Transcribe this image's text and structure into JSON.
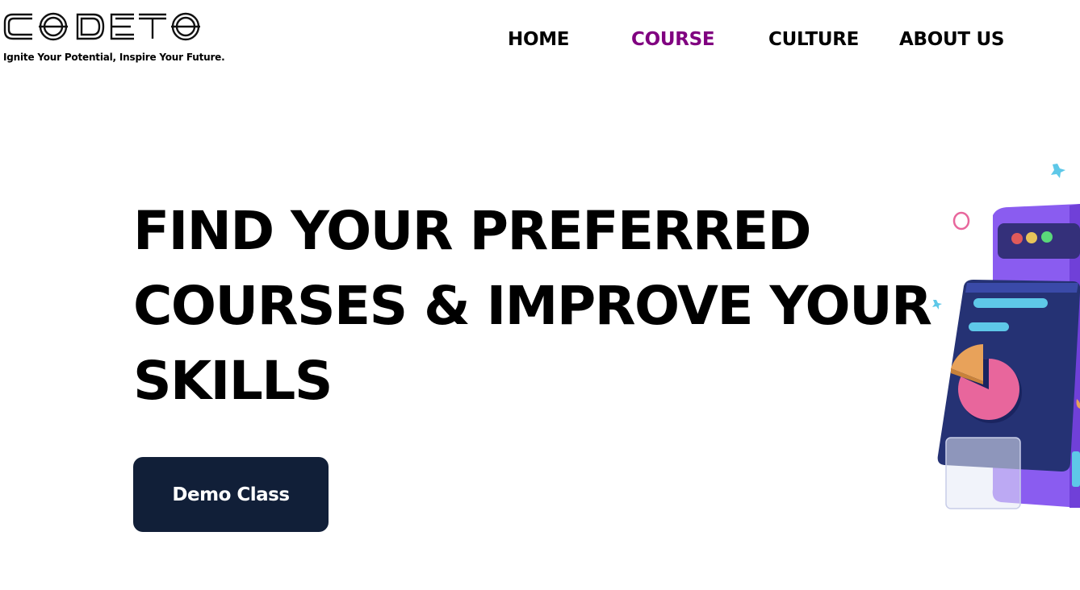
{
  "brand": {
    "logo_text": "CODETO",
    "tagline": "Ignite Your Potential, Inspire Your Future."
  },
  "nav": {
    "items": [
      {
        "label": "HOME",
        "active": false
      },
      {
        "label": "COURSE",
        "active": true
      },
      {
        "label": "CULTURE",
        "active": false
      },
      {
        "label": "ABOUT US",
        "active": false
      }
    ],
    "active_color": "#800080"
  },
  "hero": {
    "title_lines": [
      "FIND YOUR PREFERRED",
      "COURSES & IMPROVE YOUR",
      "SKILLS"
    ],
    "cta_label": "Demo Class",
    "cta_color": "#111f38"
  },
  "illustration": {
    "icon": "dashboard-illustration-icon",
    "colors": {
      "panel": "#8a5cf0",
      "card": "#2b3a8f",
      "pie_main": "#e8669c",
      "pie_slice": "#e8a25a",
      "accent": "#5ec8e8"
    }
  }
}
